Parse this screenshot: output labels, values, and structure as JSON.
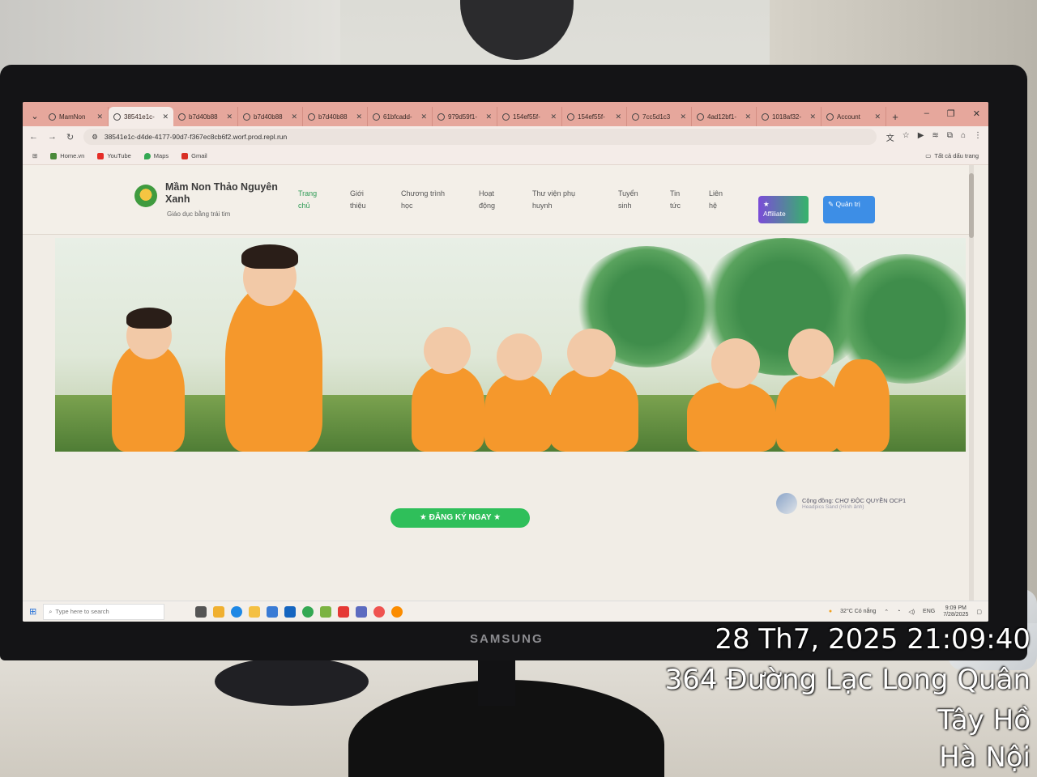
{
  "browser": {
    "tabs": [
      {
        "label": "MamNon",
        "active": false
      },
      {
        "label": "38541e1c-",
        "active": true
      },
      {
        "label": "b7d40b88",
        "active": false
      },
      {
        "label": "b7d40b88",
        "active": false
      },
      {
        "label": "b7d40b88",
        "active": false
      },
      {
        "label": "61bfcadd-",
        "active": false
      },
      {
        "label": "979d59f1-",
        "active": false
      },
      {
        "label": "154ef55f-",
        "active": false
      },
      {
        "label": "154ef55f-",
        "active": false
      },
      {
        "label": "7cc5d1c3",
        "active": false
      },
      {
        "label": "4ad12bf1-",
        "active": false
      },
      {
        "label": "1018af32-",
        "active": false
      },
      {
        "label": "Account",
        "active": false
      }
    ],
    "url": "38541e1c-d4de-4177-90d7-f367ec8cb6f2.worf.prod.repl.run",
    "bookmarks": [
      "Home.vn",
      "YouTube",
      "Maps",
      "Gmail"
    ],
    "all_bookmarks_label": "Tất cả dấu trang"
  },
  "site": {
    "title": "Mầm Non Thảo Nguyên Xanh",
    "tagline": "Giáo dục bằng trái tim",
    "menu": [
      {
        "label1": "Trang",
        "label2": "chủ",
        "active": true
      },
      {
        "label1": "Giới",
        "label2": "thiệu",
        "active": false
      },
      {
        "label1": "Chương trình",
        "label2": "học",
        "active": false
      },
      {
        "label1": "Hoạt",
        "label2": "động",
        "active": false
      },
      {
        "label1": "Thư viện phụ",
        "label2": "huynh",
        "active": false
      },
      {
        "label1": "Tuyển",
        "label2": "sinh",
        "active": false
      },
      {
        "label1": "Tin",
        "label2": "tức",
        "active": false
      },
      {
        "label1": "Liên",
        "label2": "hệ",
        "active": false
      }
    ],
    "affiliate_label": "Affiliate",
    "admin_label": "Quản trị",
    "cta_label": "ĐĂNG KÝ NGAY",
    "community_title": "Cộng đồng: CHỢ ĐỘC QUYỀN OCP1",
    "community_sub": "Headpics Sand (Hình ảnh)"
  },
  "taskbar": {
    "search_placeholder": "Type here to search",
    "weather": "32°C  Có nắng",
    "lang": "ENG",
    "time": "9:09 PM",
    "date": "7/28/2025"
  },
  "monitor_brand": "SAMSUNG",
  "stamp": {
    "datetime": "28 Th7, 2025 21:09:40",
    "address1": "364 Đường Lạc Long Quân",
    "address2": "Tây Hồ",
    "city": "Hà Nội"
  },
  "colors": {
    "tabstrip": "#e6a79c",
    "accent_green": "#2fbf5a",
    "admin_blue": "#3d8ee6",
    "kid_shirt": "#f5982c"
  }
}
